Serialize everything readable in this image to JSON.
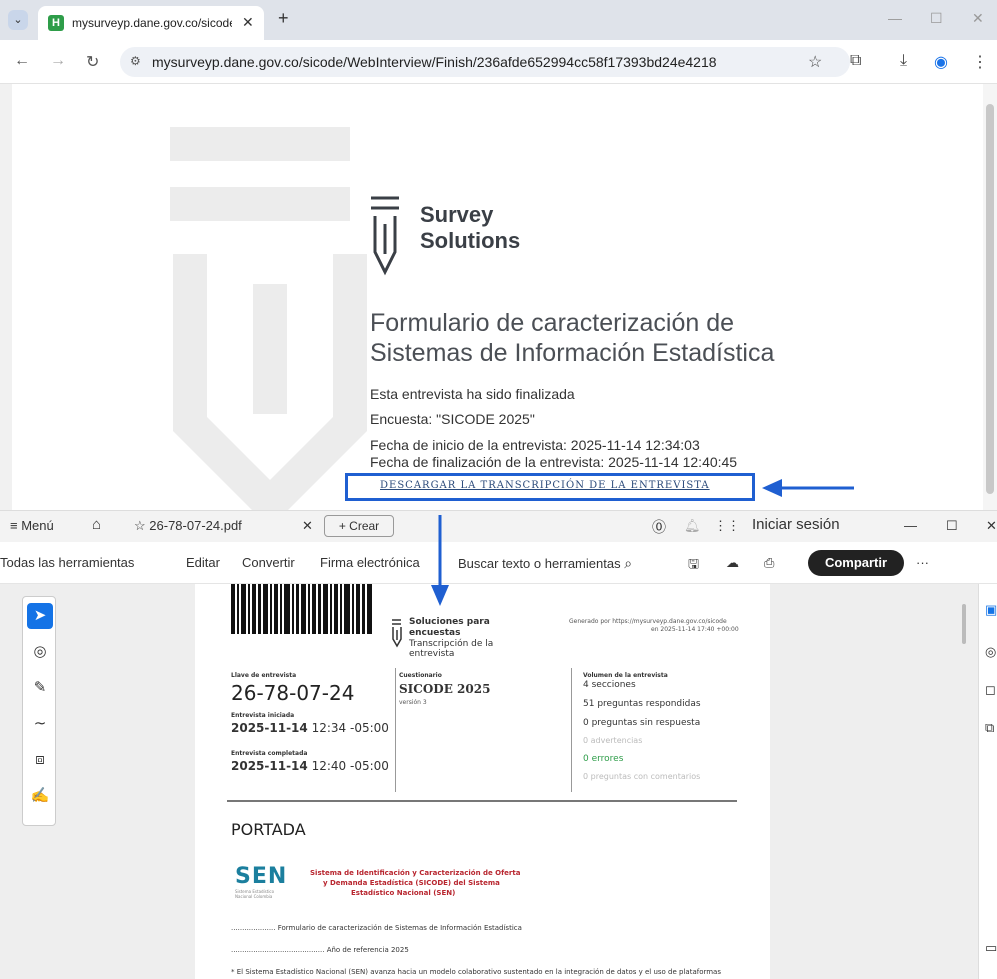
{
  "browser": {
    "tab_title": "mysurveyp.dane.gov.co/sicode/",
    "favicon_letter": "H",
    "url": "mysurveyp.dane.gov.co/sicode/WebInterview/Finish/236afde652994cc58f17393bd24e4218"
  },
  "survey": {
    "logo_line1": "Survey",
    "logo_line2": "Solutions",
    "form_title_line1": "Formulario de caracterización de",
    "form_title_line2": "Sistemas de Información Estadística",
    "finished": "Esta entrevista ha sido finalizada",
    "survey_name": "Encuesta: \"SICODE 2025\"",
    "start_date": "Fecha de inicio de la entrevista: 2025-11-14 12:34:03",
    "end_date": "Fecha de finalización de la entrevista: 2025-11-14 12:40:45",
    "download_link": "DESCARGAR LA TRANSCRIPCIÓN DE LA ENTREVISTA"
  },
  "pdf_app": {
    "menu": "Menú",
    "file_tab": "26-78-07-24.pdf",
    "create": "Crear",
    "sign_in": "Iniciar sesión",
    "tools": [
      "Todas las herramientas",
      "Editar",
      "Convertir",
      "Firma electrónica"
    ],
    "search": "Buscar texto o herramientas",
    "share": "Compartir"
  },
  "doc": {
    "brand_line1": "Soluciones para",
    "brand_line2": "encuestas",
    "brand_sub1": "Transcripción de la",
    "brand_sub2": "entrevista",
    "generated_line1": "Generado por https://mysurveyp.dane.gov.co/sicode",
    "generated_line2": "en 2025-11-14 17:40 +00:00",
    "key_label": "Llave de entrevista",
    "key_value": "26-78-07-24",
    "started_label": "Entrevista iniciada",
    "started_date": "2025-11-14",
    "started_time": "12:34 -05:00",
    "completed_label": "Entrevista completada",
    "completed_date": "2025-11-14",
    "completed_time": "12:40 -05:00",
    "questionnaire_label": "Cuestionario",
    "questionnaire_value": "SICODE 2025",
    "version": "versión 3",
    "volume_label": "Volumen de la entrevista",
    "sections": "4 secciones",
    "answered": "51 preguntas respondidas",
    "unanswered": "0 preguntas sin respuesta",
    "warnings": "0 advertencias",
    "errors": "0 errores",
    "comments": "0 preguntas con comentarios",
    "section_title": "PORTADA",
    "sen_logo": "SEN",
    "sen_logo_sub1": "Sistema Estadístico",
    "sen_logo_sub2": "Nacional Colombia",
    "sen_title1": "Sistema de Identificación y Caracterización de Oferta",
    "sen_title2": "y Demanda Estadística (SICODE) del Sistema",
    "sen_title3": "Estadístico Nacional (SEN)",
    "form_line": "Formulario de caracterización de Sistemas de Información Estadística",
    "year_line": "Año de referencia 2025",
    "body_text": "* El Sistema Estadístico Nacional (SEN) avanza hacia un modelo colaborativo sustentado en la integración de datos y el uso de plataformas"
  }
}
